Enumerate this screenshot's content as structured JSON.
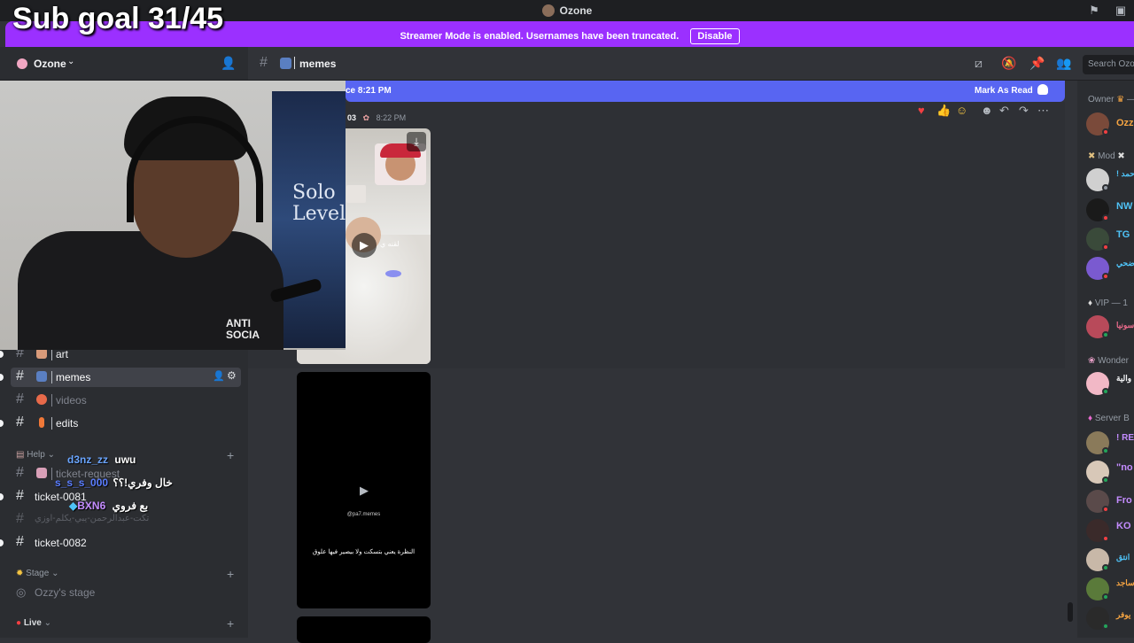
{
  "overlay": {
    "sub_goal": "Sub goal 31/45"
  },
  "titlebar": {
    "title": "Ozone"
  },
  "banner": {
    "message": "Streamer Mode is enabled. Usernames have been truncated.",
    "disable_label": "Disable"
  },
  "server": {
    "name": "Ozone"
  },
  "channel_header": {
    "name": "memes",
    "search_placeholder": "Search Ozone"
  },
  "new_messages": {
    "text": "ce 8:21 PM",
    "mark_as_read": "Mark As Read"
  },
  "message": {
    "author": "03",
    "time": "8:22 PM"
  },
  "channels": [
    {
      "name": "art"
    },
    {
      "name": "memes"
    },
    {
      "name": "videos"
    },
    {
      "name": "edits"
    },
    {
      "name": "ticket-request"
    },
    {
      "name": "ticket-0081"
    },
    {
      "name": "تكت-عبدالرحمن-يبي-يكلم-اوزي"
    },
    {
      "name": "ticket-0082"
    }
  ],
  "categories": {
    "help": "Help",
    "stage": "Stage",
    "live": "Live"
  },
  "stage_channel": "Ozzy's stage",
  "videos": {
    "v1_caption": "لقنه ي",
    "v2_watermark": "@pa7.memes",
    "v2_caption": "النظرة يعني بتسكت ولا بيصير فيها علوق"
  },
  "chat_overlay": [
    {
      "user": "d3nz_zz",
      "text": "uwu",
      "user_color": "#6aa5ff"
    },
    {
      "user": "s_s_s_000",
      "text": "خال وفري!؟؟",
      "user_color": "#5a7dff"
    },
    {
      "user": "BXN6",
      "text": "بع فروي",
      "user_color": "#c48cff"
    }
  ],
  "members": {
    "categories": [
      "Owner",
      "Mod",
      "VIP — 1",
      "Wonder",
      "Server B"
    ],
    "names": [
      "Ozz",
      "! حمد",
      "NW",
      "TG",
      "اضحي",
      "سونيا",
      "والية",
      "! RE",
      "\"no",
      "Fro",
      "KO",
      "انتق",
      "ساجد",
      "يوفر"
    ]
  },
  "webcam": {
    "poster_text": "Solo Leveli",
    "shirt_text": "ANTI SOCIA"
  },
  "colors": {
    "accent": "#5865f2",
    "banner": "#9b30ff",
    "bg": "#313338",
    "sidebar": "#2b2d31"
  }
}
